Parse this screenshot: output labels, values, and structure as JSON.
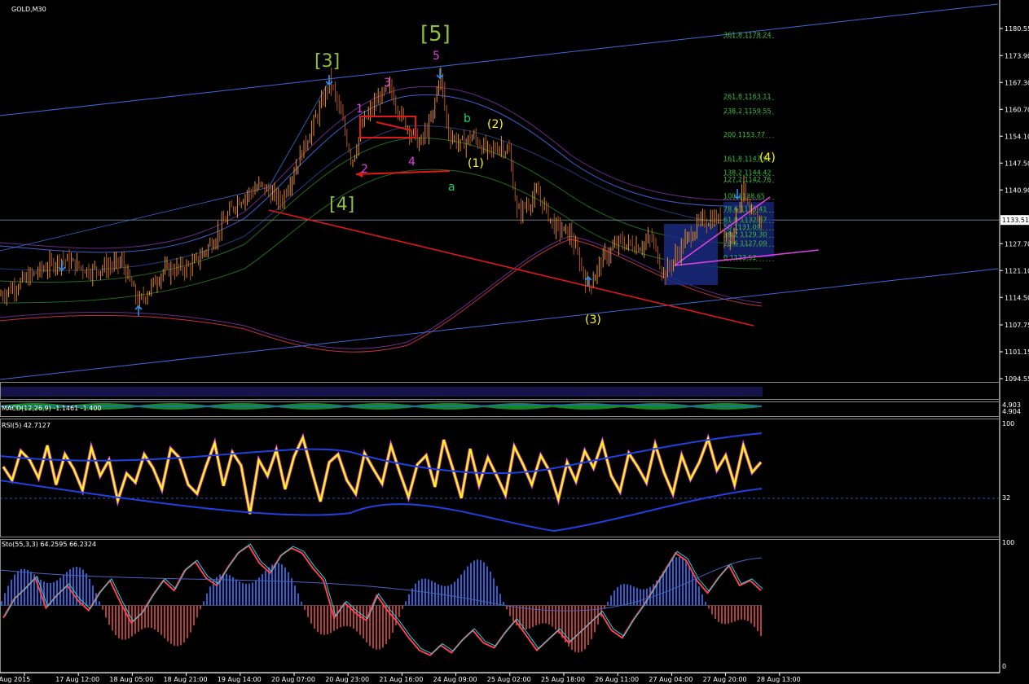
{
  "chart_data": {
    "type": "candlestick",
    "symbol_title": "GOLD,M30",
    "price_axis": {
      "ticks": [
        "1180.55",
        "1173.90",
        "1167.30",
        "1160.70",
        "1154.10",
        "1147.50",
        "1140.90",
        "1133.51",
        "1127.70",
        "1121.10",
        "1114.50",
        "1107.75",
        "1101.15",
        "1094.55"
      ],
      "current": "1133.51"
    },
    "time_axis": [
      "14 Aug 2015",
      "17 Aug 12:00",
      "18 Aug 05:00",
      "18 Aug 21:00",
      "19 Aug 14:00",
      "20 Aug 07:00",
      "20 Aug 23:00",
      "21 Aug 16:00",
      "24 Aug 09:00",
      "25 Aug 02:00",
      "25 Aug 18:00",
      "26 Aug 11:00",
      "27 Aug 04:00",
      "27 Aug 20:00",
      "28 Aug 13:00"
    ],
    "price_path": [
      [
        0,
        1115
      ],
      [
        40,
        1120
      ],
      [
        75,
        1124
      ],
      [
        110,
        1121
      ],
      [
        150,
        1123
      ],
      [
        170,
        1113
      ],
      [
        200,
        1121
      ],
      [
        235,
        1122
      ],
      [
        260,
        1128
      ],
      [
        290,
        1138
      ],
      [
        320,
        1142
      ],
      [
        345,
        1138
      ],
      [
        370,
        1150
      ],
      [
        395,
        1162
      ],
      [
        405,
        1168
      ],
      [
        420,
        1158
      ],
      [
        432,
        1148
      ],
      [
        445,
        1157
      ],
      [
        460,
        1162
      ],
      [
        478,
        1166
      ],
      [
        495,
        1158
      ],
      [
        515,
        1152
      ],
      [
        530,
        1158
      ],
      [
        540,
        1170
      ],
      [
        550,
        1155
      ],
      [
        565,
        1152
      ],
      [
        580,
        1154
      ],
      [
        600,
        1150
      ],
      [
        615,
        1152
      ],
      [
        625,
        1150
      ],
      [
        635,
        1135
      ],
      [
        660,
        1140
      ],
      [
        680,
        1132
      ],
      [
        700,
        1130
      ],
      [
        722,
        1117
      ],
      [
        740,
        1124
      ],
      [
        760,
        1128
      ],
      [
        785,
        1127
      ],
      [
        800,
        1129
      ],
      [
        815,
        1120
      ],
      [
        840,
        1128
      ],
      [
        860,
        1133
      ],
      [
        880,
        1134
      ],
      [
        895,
        1128
      ],
      [
        905,
        1136
      ],
      [
        912,
        1142
      ],
      [
        920,
        1134
      ],
      [
        935,
        1134
      ]
    ],
    "wave_labels": [
      {
        "text": "[3]",
        "color": "#8fbf3a"
      },
      {
        "text": "[5]",
        "color": "#8fbf3a"
      },
      {
        "text": "[4]",
        "color": "#8fbf3a"
      },
      {
        "text": "1",
        "color": "#e040e0"
      },
      {
        "text": "2",
        "color": "#e040e0"
      },
      {
        "text": "3",
        "color": "#e040e0"
      },
      {
        "text": "4",
        "color": "#e040e0"
      },
      {
        "text": "5",
        "color": "#e040e0"
      },
      {
        "text": "b",
        "color": "#20d070"
      },
      {
        "text": "a",
        "color": "#20d070"
      },
      {
        "text": "(1)",
        "color": "#ffff00"
      },
      {
        "text": "(2)",
        "color": "#ffff00"
      },
      {
        "text": "(3)",
        "color": "#ffff00"
      },
      {
        "text": "(4)",
        "color": "#ffff00"
      }
    ],
    "fib_levels": [
      "361.8 1178.24",
      "261.8 1163.11",
      "238.2 1159.55",
      "200 1153.77",
      "161.8 1147.9",
      "138.2 1144.42",
      "127.2 1142.76",
      "100 1138.65",
      "78.6 1135.41",
      "61.8 1132.87",
      "50 1131.09",
      "38.2 1129.30",
      "23.6 1127.09",
      "0 1123.52"
    ],
    "macd": {
      "label": "MACD(12,26,9) -1.1461 -1.400",
      "axis": [
        "4.903",
        "4.904"
      ]
    },
    "rsi": {
      "label": "RSI(5) 42.7127",
      "axis": [
        "100",
        "32"
      ],
      "values": [
        60,
        48,
        74,
        66,
        50,
        79,
        44,
        71,
        58,
        39,
        77,
        52,
        66,
        30,
        54,
        46,
        71,
        59,
        40,
        76,
        68,
        44,
        36,
        60,
        81,
        43,
        73,
        61,
        18,
        66,
        52,
        75,
        40,
        69,
        86,
        57,
        29,
        64,
        71,
        48,
        36,
        72,
        58,
        45,
        79,
        55,
        33,
        62,
        70,
        42,
        84,
        59,
        32,
        76,
        44,
        68,
        52,
        35,
        78,
        62,
        44,
        70,
        56,
        31,
        64,
        47,
        74,
        59,
        82,
        52,
        38,
        72,
        60,
        46,
        80,
        55,
        36,
        70,
        49,
        64,
        85,
        57,
        70,
        44,
        79,
        55,
        64
      ]
    },
    "sto": {
      "label": "Sto(55,3,3) 64.2595 66.2324",
      "axis": [
        "100",
        "0"
      ],
      "values": [
        40,
        55,
        63,
        72,
        48,
        58,
        66,
        54,
        46,
        60,
        70,
        52,
        36,
        44,
        58,
        70,
        62,
        78,
        85,
        72,
        66,
        80,
        92,
        98,
        84,
        76,
        90,
        96,
        92,
        80,
        70,
        40,
        52,
        44,
        38,
        58,
        46,
        36,
        24,
        14,
        10,
        18,
        12,
        22,
        30,
        20,
        16,
        28,
        38,
        26,
        14,
        22,
        30,
        20,
        28,
        36,
        44,
        30,
        24,
        38,
        50,
        64,
        78,
        92,
        86,
        70,
        60,
        72,
        82,
        66,
        70,
        62
      ]
    }
  }
}
